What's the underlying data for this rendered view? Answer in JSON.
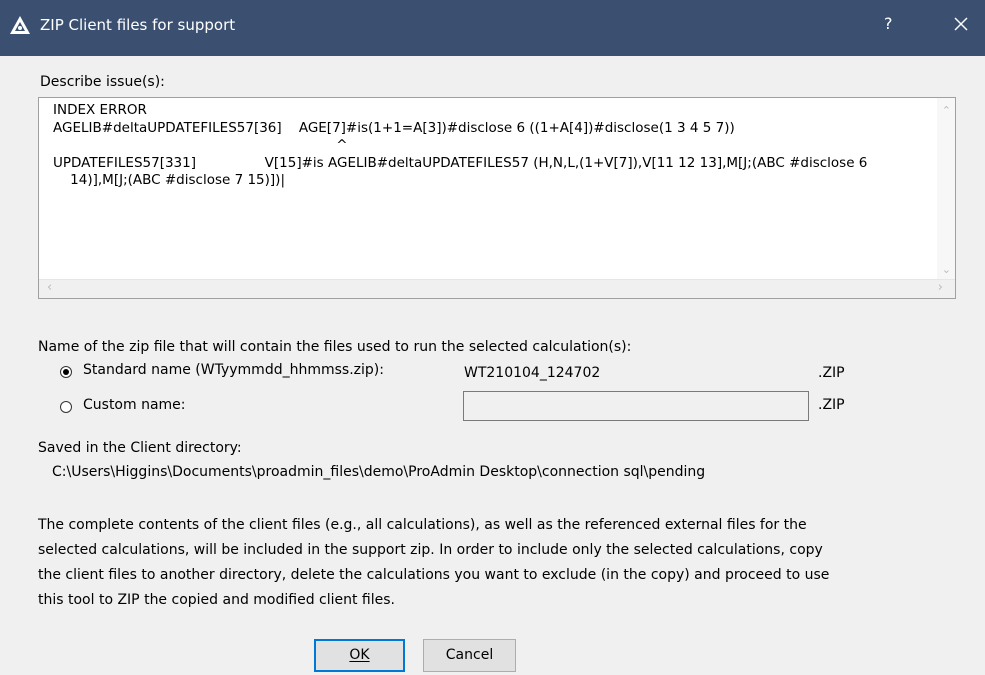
{
  "window": {
    "title": "ZIP Client files for support",
    "help_label": "?",
    "app_icon": "proadmin-app-icon",
    "close_icon": "close-icon"
  },
  "issue": {
    "label": "Describe issue(s):",
    "text": "INDEX ERROR\nAGELIB#deltaUPDATEFILES57[36]    AGE[7]#is(1+1=A[3])#disclose 6 ((1+A[4])#disclose(1 3 4 5 7))\n                                                                  ^\nUPDATEFILES57[331]                V[15]#is AGELIB#deltaUPDATEFILES57 (H,N,L,(1+V[7]),V[11 12 13],M[J;(ABC #disclose 6\n    14)],M[J;(ABC #disclose 7 15)])|"
  },
  "zip": {
    "label": "Name of the zip file that will contain the files used to run the selected calculation(s):",
    "standard_label": "Standard name (WTyymmdd_hhmmss.zip):",
    "standard_value": "WT210104_124702",
    "standard_checked": true,
    "custom_label": "Custom name:",
    "custom_value": "",
    "extension": ".ZIP"
  },
  "saved": {
    "label": "Saved in the Client directory:",
    "path": "C:\\Users\\Higgins\\Documents\\proadmin_files\\demo\\ProAdmin Desktop\\connection sql\\pending"
  },
  "info_text": "The complete contents of the client files (e.g., all calculations), as well as the referenced external files for the\nselected calculations, will be included in the support zip. In order to include only the selected calculations, copy\nthe client files to another directory, delete the calculations you want to exclude (in the copy) and proceed to use\nthis tool to ZIP the copied and modified client files.",
  "buttons": {
    "ok": "OK",
    "cancel": "Cancel"
  }
}
